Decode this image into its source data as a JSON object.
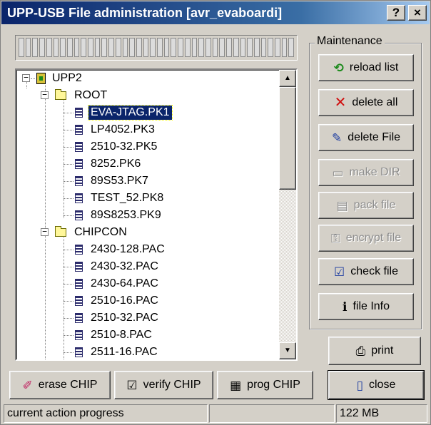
{
  "window": {
    "title": "UPP-USB File administration [avr_evaboardi]",
    "help_label": "?",
    "close_label": "×"
  },
  "tree": {
    "root": {
      "label": "UPP2",
      "icon": "drive-icon"
    },
    "folders": [
      {
        "label": "ROOT",
        "files": [
          "EVA-JTAG.PK1",
          "LP4052.PK3",
          "2510-32.PK5",
          "8252.PK6",
          "89S53.PK7",
          "TEST_52.PK8",
          "89S8253.PK9"
        ]
      },
      {
        "label": "CHIPCON",
        "files": [
          "2430-128.PAC",
          "2430-32.PAC",
          "2430-64.PAC",
          "2510-16.PAC",
          "2510-32.PAC",
          "2510-8.PAC",
          "2511-16.PAC"
        ]
      }
    ],
    "selected": "EVA-JTAG.PK1"
  },
  "maintenance": {
    "title": "Maintenance",
    "buttons": [
      {
        "label": "reload list",
        "icon": "reload-icon",
        "enabled": true
      },
      {
        "label": "delete all",
        "icon": "red-x-icon",
        "enabled": true
      },
      {
        "label": "delete File",
        "icon": "eraser-brush-icon",
        "enabled": true
      },
      {
        "label": "make DIR",
        "icon": "folder-icon",
        "enabled": false
      },
      {
        "label": "pack file",
        "icon": "pack-icon",
        "enabled": false
      },
      {
        "label": "encrypt file",
        "icon": "encrypt-icon",
        "enabled": false
      },
      {
        "label": "check file",
        "icon": "check-file-icon",
        "enabled": true
      },
      {
        "label": "file Info",
        "icon": "info-icon",
        "enabled": true
      }
    ]
  },
  "actions": {
    "print": "print",
    "close": "close",
    "erase_chip": "erase CHIP",
    "verify_chip": "verify CHIP",
    "prog_chip": "prog CHIP"
  },
  "status": {
    "action": "current action progress",
    "middle": "",
    "memory": "122 MB"
  }
}
